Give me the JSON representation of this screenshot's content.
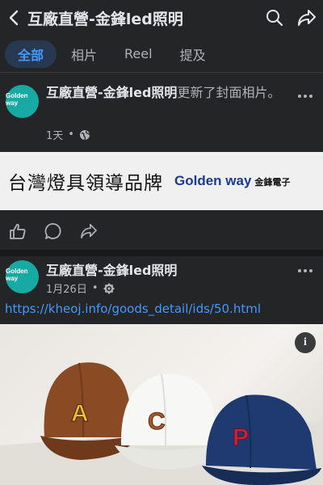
{
  "header": {
    "title": "互廠直營-金鋒led照明"
  },
  "tabs": [
    {
      "label": "全部",
      "active": true
    },
    {
      "label": "相片",
      "active": false
    },
    {
      "label": "Reel",
      "active": false
    },
    {
      "label": "提及",
      "active": false
    }
  ],
  "post1": {
    "avatar_logo": "Golden way",
    "page_name": "互廠直營-金鋒led照明",
    "action_text": "更新了封面相片。",
    "time": "1天",
    "banner": {
      "slogan": "台灣燈具領導品牌",
      "brand": "Golden way",
      "brand_cn": "金鋒電子"
    }
  },
  "post2": {
    "avatar_logo": "Golden way",
    "page_name": "互廠直營-金鋒led照明",
    "date": "1月26日",
    "link": "https://kheoj.info/goods_detail/ids/50.html",
    "caps": [
      {
        "letter": "A",
        "color": "#8a4b24",
        "letter_color": "#f2c12e"
      },
      {
        "letter": "C",
        "color": "#f7f7f5",
        "letter_color": "#a35a2a"
      },
      {
        "letter": "P",
        "color": "#1f3a70",
        "letter_color": "#c8233a"
      }
    ]
  },
  "colors": {
    "background": "#242526",
    "accent": "#4599ff",
    "muted": "#b0b3b8"
  }
}
